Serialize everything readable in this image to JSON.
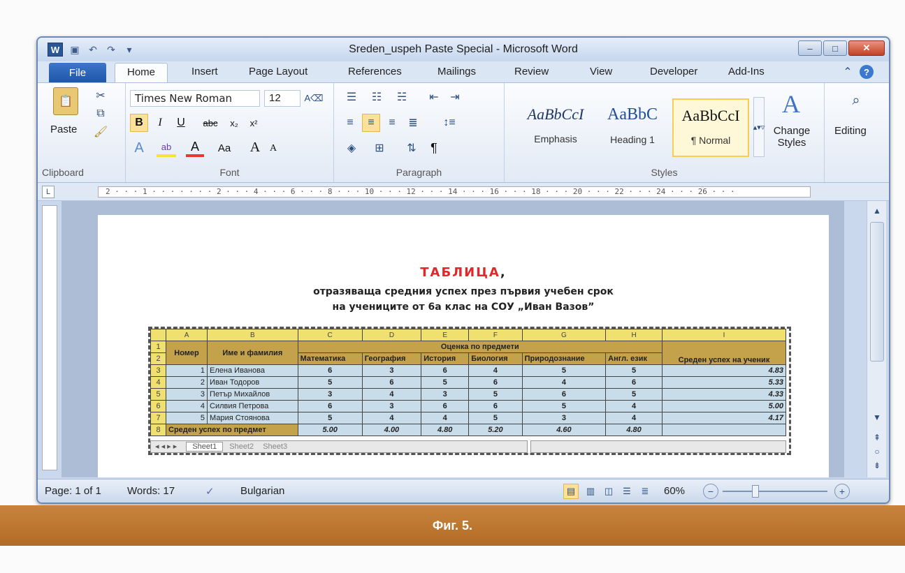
{
  "window": {
    "title": "Sreden_uspeh Paste Special - Microsoft Word",
    "app_icon": "W",
    "controls": {
      "minimize": "–",
      "maximize": "□",
      "close": "✕"
    }
  },
  "tabs": [
    "File",
    "Home",
    "Insert",
    "Page Layout",
    "References",
    "Mailings",
    "Review",
    "View",
    "Developer",
    "Add-Ins"
  ],
  "ribbon": {
    "clipboard": {
      "label": "Clipboard",
      "paste": "Paste"
    },
    "font": {
      "label": "Font",
      "family": "Times New Roman",
      "size": "12",
      "bold": "B",
      "italic": "I",
      "underline": "U",
      "strike": "abc",
      "sub": "x₂",
      "sup": "x²",
      "case": "Aa",
      "grow": "A",
      "shrink": "A"
    },
    "paragraph": {
      "label": "Paragraph",
      "pilcrow": "¶"
    },
    "styles": {
      "label": "Styles",
      "items": [
        {
          "sample": "AaBbCcI",
          "name": "Emphasis"
        },
        {
          "sample": "AaBbC",
          "name": "Heading 1"
        },
        {
          "sample": "AaBbCcI",
          "name": "¶ Normal"
        }
      ],
      "change": "Change Styles"
    },
    "editing": {
      "label": "Editing"
    }
  },
  "ruler": "2 · · · 1 · · · · · · · 2 · · · 4 · · · 6 · · · 8 · · · 10 · · · 12 · · · 14 · · · 16 · · · 18 · · · 20 · · · 22 · · · 24 · · · 26 · · ·",
  "document": {
    "heading": "ТАБЛИЦА",
    "heading_comma": ",",
    "line1": "отразяваща средния успех през първия учебен срок",
    "line2": "на учениците от 6а клас на СОУ „Иван Вазов”"
  },
  "sheet": {
    "col_letters": [
      "A",
      "B",
      "C",
      "D",
      "E",
      "F",
      "G",
      "H",
      "I"
    ],
    "group_header": "Оценка по предмети",
    "col_headers": [
      "Номер",
      "Име и фамилия",
      "Математика",
      "География",
      "История",
      "Биология",
      "Природознание",
      "Англ. език",
      "Среден успех на ученик"
    ],
    "rows": [
      {
        "n": "1",
        "name": "Елена Иванова",
        "grades": [
          "6",
          "3",
          "6",
          "4",
          "5",
          "5"
        ],
        "avg": "4.83"
      },
      {
        "n": "2",
        "name": "Иван Тодоров",
        "grades": [
          "5",
          "6",
          "5",
          "6",
          "4",
          "6"
        ],
        "avg": "5.33"
      },
      {
        "n": "3",
        "name": "Петър Михайлов",
        "grades": [
          "3",
          "4",
          "3",
          "5",
          "6",
          "5"
        ],
        "avg": "4.33"
      },
      {
        "n": "4",
        "name": "Силвия Петрова",
        "grades": [
          "6",
          "3",
          "6",
          "6",
          "5",
          "4"
        ],
        "avg": "5.00"
      },
      {
        "n": "5",
        "name": "Мария Стоянова",
        "grades": [
          "5",
          "4",
          "4",
          "5",
          "3",
          "4"
        ],
        "avg": "4.17"
      }
    ],
    "footer_label": "Среден успех по предмет",
    "footer_values": [
      "5.00",
      "4.00",
      "4.80",
      "5.20",
      "4.60",
      "4.80"
    ],
    "sheet_tabs": [
      "Sheet1",
      "Sheet2",
      "Sheet3"
    ]
  },
  "status": {
    "page": "Page: 1 of 1",
    "words": "Words: 17",
    "language": "Bulgarian",
    "zoom": "60%"
  },
  "caption": "Фиг. 5."
}
